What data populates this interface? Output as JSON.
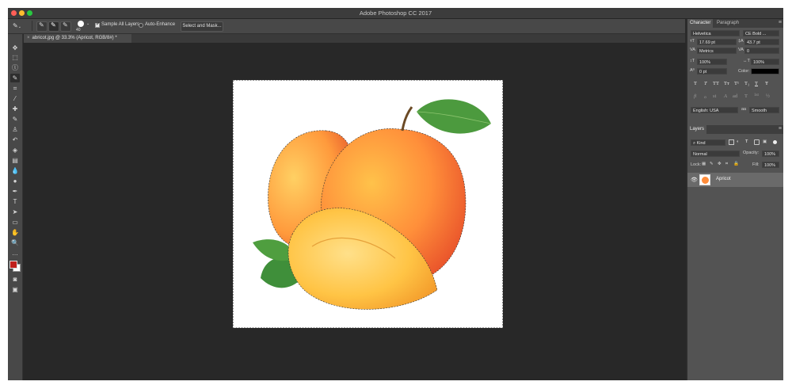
{
  "app": {
    "title": "Adobe Photoshop CC 2017"
  },
  "window_controls": [
    {
      "name": "close",
      "color": "#ff5f57"
    },
    {
      "name": "minimize",
      "color": "#febc2e"
    },
    {
      "name": "maximize",
      "color": "#28c840"
    }
  ],
  "options_bar": {
    "brush_size": "40",
    "sample_all_layers_label": "Sample All Layers",
    "auto_enhance_label": "Auto-Enhance",
    "select_and_mask_label": "Select and Mask..."
  },
  "document": {
    "tab_label": "abricot.jpg @ 33.3% (Apricot, RGB/8#) *"
  },
  "character_panel": {
    "tabs": [
      "Character",
      "Paragraph"
    ],
    "font_family": "Helvetica",
    "font_style": "CE Bold ...",
    "font_size": "17.69 pt",
    "leading": "43.7 pt",
    "kerning": "Metrics",
    "tracking": "0",
    "vertical_scale": "100%",
    "horizontal_scale": "100%",
    "baseline_shift": "0 pt",
    "color_label": "Color:",
    "type_style_buttons": [
      "T",
      "T",
      "TT",
      "Tт",
      "T¹",
      "T₁",
      "T",
      "Ŧ"
    ],
    "opentype_buttons": [
      "fi",
      "ℴ",
      "st",
      "A",
      "ad",
      "T",
      "1st",
      "½"
    ],
    "language": "English: USA",
    "antialias": "Smooth",
    "antialias_prefix": "aa"
  },
  "layers_panel": {
    "title": "Layers",
    "filter_kind": "Kind",
    "blend_mode": "Normal",
    "opacity_label": "Opacity:",
    "opacity": "100%",
    "lock_label": "Lock:",
    "fill_label": "Fill:",
    "fill": "100%",
    "layers": [
      {
        "name": "Apricot",
        "visible": true
      }
    ]
  },
  "colors": {
    "foreground": "#c0201c",
    "background": "#ffffff",
    "app_bg": "#2b2b2b",
    "panel_bg": "#535353"
  }
}
